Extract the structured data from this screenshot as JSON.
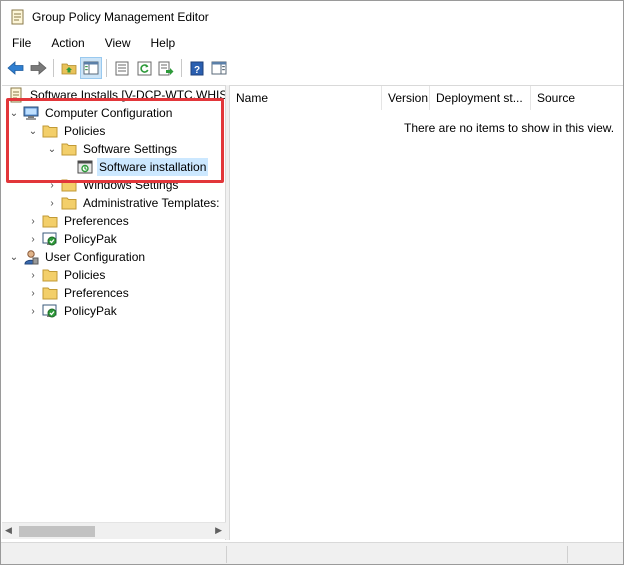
{
  "window": {
    "title": "Group Policy Management Editor"
  },
  "menu": [
    "File",
    "Action",
    "View",
    "Help"
  ],
  "toolbar": {
    "buttons": [
      "back-icon",
      "forward-icon",
      "up-folder-icon",
      "show-hide-tree-icon",
      "properties-icon",
      "refresh-icon",
      "export-list-icon",
      "help-icon",
      "action-pane-icon"
    ]
  },
  "tree": {
    "root": "Software Installs [V-DCP-WTC.WHISK",
    "computer_configuration": "Computer Configuration",
    "cc_policies": "Policies",
    "cc_software_settings": "Software Settings",
    "cc_software_installation": "Software installation",
    "cc_windows_settings": "Windows Settings",
    "cc_admin_templates": "Administrative Templates:",
    "cc_preferences": "Preferences",
    "cc_policypak": "PolicyPak",
    "user_configuration": "User Configuration",
    "uc_policies": "Policies",
    "uc_preferences": "Preferences",
    "uc_policypak": "PolicyPak"
  },
  "list": {
    "columns": [
      "Name",
      "Version",
      "Deployment st...",
      "Source"
    ],
    "empty_message": "There are no items to show in this view."
  },
  "colors": {
    "highlight_box": "#e2363a",
    "selection": "#cce8ff"
  }
}
